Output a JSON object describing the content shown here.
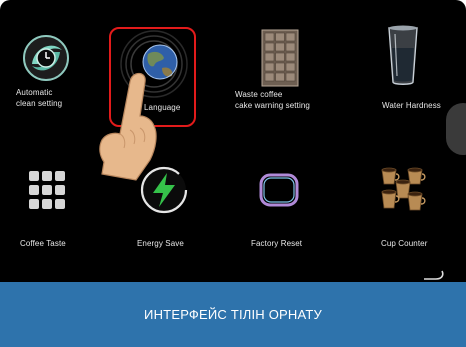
{
  "settings": {
    "items": [
      {
        "label_line1": "Automatic",
        "label_line2": "clean setting",
        "icon": "clean-icon"
      },
      {
        "label": "Language",
        "icon": "globe-icon"
      },
      {
        "label_line1": "Waste coffee",
        "label_line2": "cake warning setting",
        "icon": "waste-bin-icon"
      },
      {
        "label": "Water Hardness",
        "icon": "water-glass-icon"
      },
      {
        "label": "Coffee Taste",
        "icon": "taste-grid-icon"
      },
      {
        "label": "Energy Save",
        "icon": "lightning-icon"
      },
      {
        "label": "Factory Reset",
        "icon": "reset-icon"
      },
      {
        "label": "Cup Counter",
        "icon": "cups-icon"
      }
    ]
  },
  "caption": {
    "text": "ИНТЕРФЕЙС ТІЛІН ОРНАТУ"
  },
  "colors": {
    "highlight": "#e21b1b",
    "caption_bg": "#2e73ac",
    "screen_bg": "#000000"
  }
}
